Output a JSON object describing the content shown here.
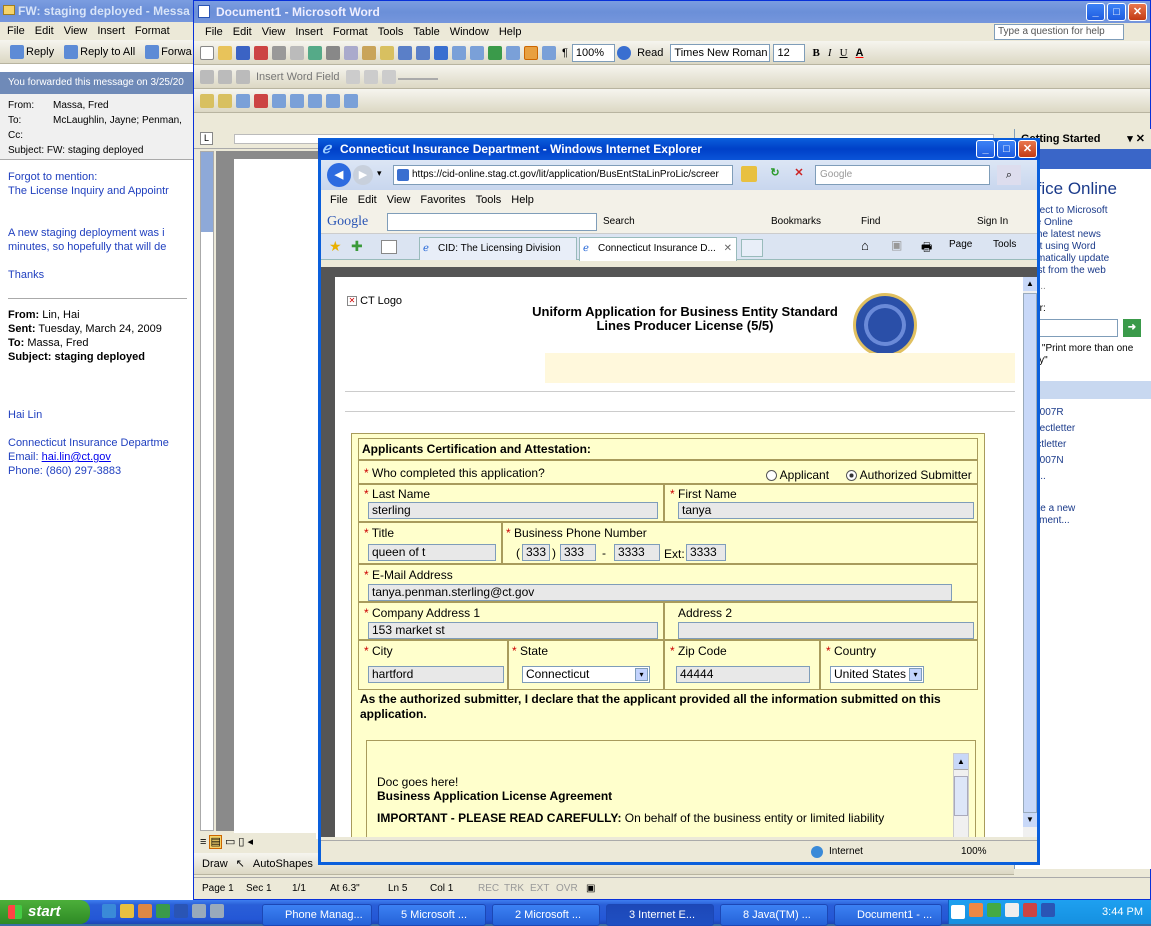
{
  "outlook": {
    "title": "FW: staging deployed - Messa",
    "menu": [
      "File",
      "Edit",
      "View",
      "Insert",
      "Format"
    ],
    "toolbar": [
      "Reply",
      "Reply to All",
      "Forwa"
    ],
    "info_bar": "You forwarded this message on 3/25/20",
    "from_label": "From:",
    "from_value": "Massa, Fred",
    "to_label": "To:",
    "to_value": "McLaughlin, Jayne; Penman,",
    "cc_label": "Cc:",
    "subject_label": "Subject:",
    "subject_value": "FW: staging deployed",
    "body1": "Forgot to mention:",
    "body2": "The License Inquiry and Appointr",
    "body3": "A new staging deployment was i",
    "body4": "minutes, so hopefully that will de",
    "body5": "Thanks",
    "orig_from_label": "From:",
    "orig_from": "Lin, Hai",
    "orig_sent_label": "Sent:",
    "orig_sent": "Tuesday, March 24, 2009",
    "orig_to_label": "To:",
    "orig_to": "Massa, Fred",
    "orig_subject_label": "Subject:",
    "orig_subject": "staging deployed",
    "sig_name": "Hai Lin",
    "sig_org": "Connecticut Insurance Departme",
    "sig_email_label": "Email:",
    "sig_email": "hai.lin@ct.gov",
    "sig_phone": "Phone:  (860) 297-3883"
  },
  "word": {
    "title": "Document1 - Microsoft Word",
    "menu": [
      "File",
      "Edit",
      "View",
      "Insert",
      "Format",
      "Tools",
      "Table",
      "Window",
      "Help"
    ],
    "ask_placeholder": "Type a question for help",
    "zoom": "100%",
    "read_label": "Read",
    "font_name": "Times New Roman",
    "font_size": "12",
    "insert_word_field": "Insert Word Field",
    "getting_started": "Getting Started",
    "office_online": "Office Online",
    "pane_items": [
      "onnect to Microsoft",
      "ffice Online",
      "et the latest news",
      "bout using Word",
      "utomatically update",
      "is list from the web",
      "ore..."
    ],
    "search_for": "h for:",
    "example": "ple: \"Print more than one copy\"",
    "recent_header": "n",
    "recent_files": [
      "en2007R",
      "_rejectletter",
      "ejectletter",
      "en2007N",
      "ore..."
    ],
    "create_new": "reate a new",
    "create_new2": "ocument...",
    "draw_label": "Draw",
    "autoshapes_label": "AutoShapes",
    "status": {
      "page": "Page 1",
      "sec": "Sec 1",
      "pages": "1/1",
      "at": "At 6.3\"",
      "ln": "Ln 5",
      "col": "Col 1",
      "rec": "REC",
      "trk": "TRK",
      "ext": "EXT",
      "ovr": "OVR"
    }
  },
  "ie": {
    "title": "Connecticut Insurance Department - Windows Internet Explorer",
    "url": "https://cid-online.stag.ct.gov/lit/application/BusEntStaLinProLic/screer",
    "search_placeholder": "Google",
    "menu": [
      "File",
      "Edit",
      "View",
      "Favorites",
      "Tools",
      "Help"
    ],
    "google_label": "Google",
    "search_btn": "Search",
    "bookmarks": "Bookmarks",
    "find": "Find",
    "sign_in": "Sign In",
    "tab1": "CID: The Licensing Division",
    "tab2": "Connecticut Insurance D...",
    "page_btn": "Page",
    "tools_btn": "Tools",
    "status_zone": "Internet",
    "status_zoom": "100%"
  },
  "form": {
    "logo_alt": "CT Logo",
    "title_line1": "Uniform Application for Business Entity Standard",
    "title_line2": "Lines Producer License (5/5)",
    "section_title": "Applicants Certification and Attestation:",
    "who_completed": "Who completed this application?",
    "opt_applicant": "Applicant",
    "opt_authorized": "Authorized Submitter",
    "last_name_label": "Last Name",
    "last_name": "sterling",
    "first_name_label": "First Name",
    "first_name": "tanya",
    "title_label": "Title",
    "title_value": "queen of t",
    "phone_label": "Business Phone Number",
    "phone_area": "333",
    "phone_prefix": "333",
    "phone_line": "3333",
    "ext_label": "Ext:",
    "phone_ext": "3333",
    "email_label": "E-Mail Address",
    "email": "tanya.penman.sterling@ct.gov",
    "address1_label": "Company Address 1",
    "address1": "153 market st",
    "address2_label": "Address 2",
    "address2": "",
    "city_label": "City",
    "city": "hartford",
    "state_label": "State",
    "state": "Connecticut",
    "zip_label": "Zip Code",
    "zip": "44444",
    "country_label": "Country",
    "country": "United States",
    "declaration": "As the authorized submitter, I declare that the applicant provided all the information submitted on this application.",
    "doc_line1": "Doc goes here!",
    "doc_line2": "Business Application License Agreement",
    "doc_important": "IMPORTANT - PLEASE READ CAREFULLY:",
    "doc_rest": " On behalf of the business entity or limited liability"
  },
  "taskbar": {
    "start": "start",
    "buttons": [
      "Phone Manag...",
      "5 Microsoft ...",
      "2 Microsoft ...",
      "3 Internet E...",
      "8 Java(TM) ...",
      "Document1 - ..."
    ],
    "clock": "3:44 PM"
  },
  "colors": {
    "form_bg": "#ffffcc",
    "desktop": "#3a6ea5",
    "title_blue": "#0a5fdc"
  }
}
